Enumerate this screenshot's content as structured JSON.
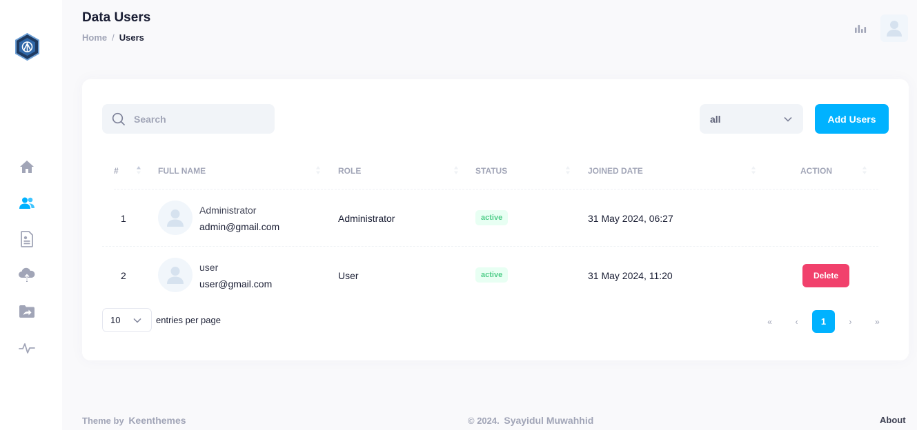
{
  "header": {
    "title": "Data Users",
    "breadcrumb": {
      "home": "Home",
      "separator": "/",
      "current": "Users"
    }
  },
  "sidebar": {
    "items": [
      {
        "name": "home",
        "icon": "home-icon"
      },
      {
        "name": "users",
        "icon": "users-icon",
        "active": true
      },
      {
        "name": "documents",
        "icon": "document-icon"
      },
      {
        "name": "upload",
        "icon": "cloud-upload-icon"
      },
      {
        "name": "shared-folder",
        "icon": "folder-share-icon"
      },
      {
        "name": "activity",
        "icon": "activity-icon"
      }
    ]
  },
  "toolbar": {
    "search_placeholder": "Search",
    "role_filter": "all",
    "add_label": "Add Users"
  },
  "table": {
    "columns": [
      "#",
      "Full Name",
      "Role",
      "Status",
      "Joined Date",
      "Action"
    ],
    "rows": [
      {
        "no": "1",
        "name": "Administrator",
        "email": "admin@gmail.com",
        "role": "Administrator",
        "status": "active",
        "joined": "31 May 2024, 06:27",
        "action": ""
      },
      {
        "no": "2",
        "name": "user",
        "email": "user@gmail.com",
        "role": "User",
        "status": "active",
        "joined": "31 May 2024, 11:20",
        "action": "Delete"
      }
    ]
  },
  "pagination": {
    "page_size": "10",
    "entries_label": "entries per page",
    "first": "«",
    "prev": "‹",
    "current": "1",
    "next": "›",
    "last": "»"
  },
  "footer": {
    "theme_prefix": "Theme by",
    "theme_name": "Keenthemes",
    "copyright": "© 2024.",
    "author": "Syayidul Muwahhid",
    "about": "About"
  },
  "colors": {
    "primary": "#00b2ff",
    "danger": "#f1416c",
    "success": "#50cd89",
    "success_light": "#e8fff3",
    "muted": "#a1a5b7"
  }
}
